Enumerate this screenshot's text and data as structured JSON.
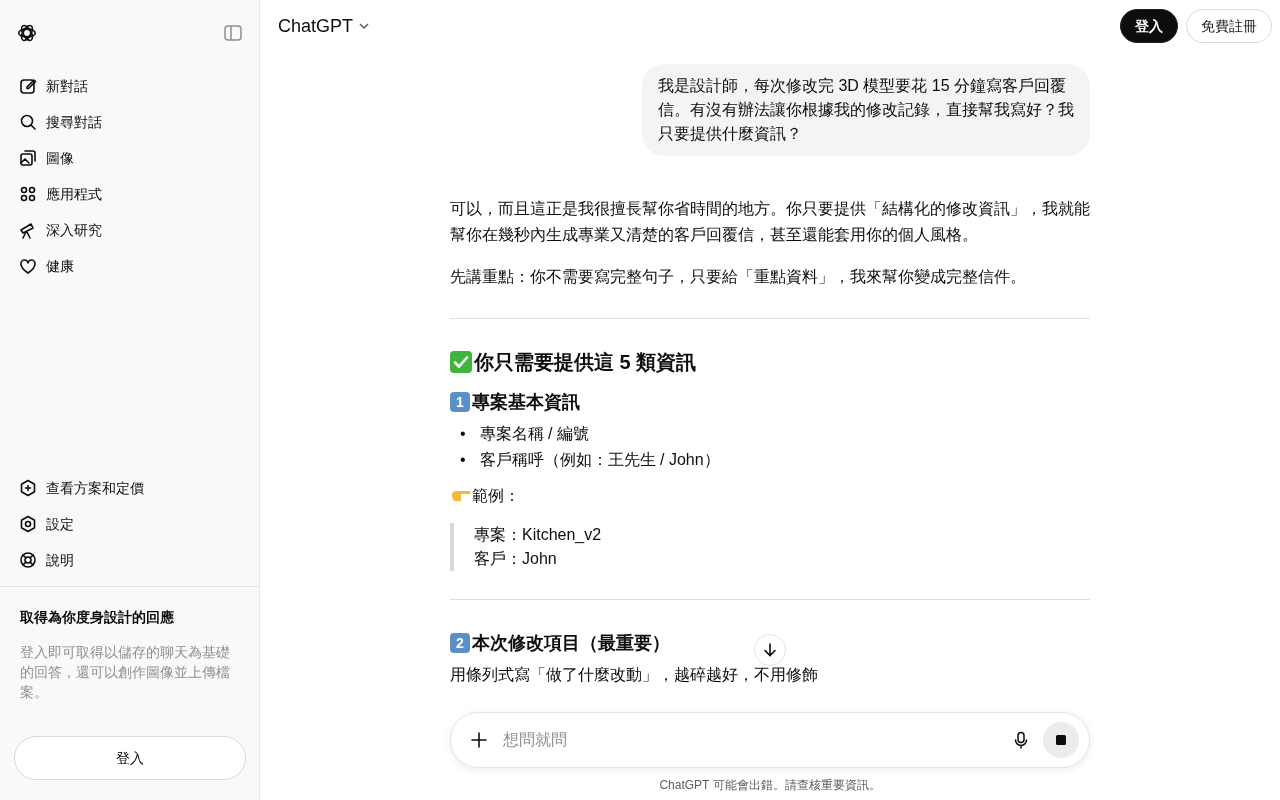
{
  "sidebar": {
    "nav": [
      {
        "kind": "edit",
        "label": "新對話"
      },
      {
        "kind": "search",
        "label": "搜尋對話"
      },
      {
        "kind": "images",
        "label": "圖像"
      },
      {
        "kind": "apps",
        "label": "應用程式"
      },
      {
        "kind": "telescope",
        "label": "深入研究"
      },
      {
        "kind": "heart",
        "label": "健康"
      }
    ],
    "footer_nav": [
      {
        "kind": "plan",
        "label": "查看方案和定價"
      },
      {
        "kind": "settings",
        "label": "設定"
      },
      {
        "kind": "help",
        "label": "說明"
      }
    ],
    "promo": {
      "title": "取得為你度身設計的回應",
      "text": "登入即可取得以儲存的聊天為基礎的回答，還可以創作圖像並上傳檔案。",
      "button": "登入"
    }
  },
  "header": {
    "title": "ChatGPT",
    "login": "登入",
    "signup": "免費註冊"
  },
  "conversation": {
    "user_message": "我是設計師，每次修改完 3D 模型要花 15 分鐘寫客戶回覆信。有沒有辦法讓你根據我的修改記錄，直接幫我寫好？我只要提供什麼資訊？",
    "answer": [
      {
        "kind": "paragraph",
        "text": "可以，而且這正是我很擅長幫你省時間的地方。你只要提供「結構化的修改資訊」，我就能幫你在幾秒內生成專業又清楚的客戶回覆信，甚至還能套用你的個人風格。"
      },
      {
        "kind": "paragraph",
        "text": "先講重點：你不需要寫完整句子，只要給「重點資料」，我來幫你變成完整信件。"
      },
      {
        "kind": "rule"
      },
      {
        "kind": "heading",
        "text": "你只需要提供這 5 類資訊"
      },
      {
        "kind": "subheading",
        "number": "1",
        "text": "專案基本資訊"
      },
      {
        "kind": "bullets",
        "marker": "•",
        "items": [
          "專案名稱 / 編號",
          "客戶稱呼（例如：王先生 / John）"
        ]
      },
      {
        "kind": "pointer",
        "text": "範例："
      },
      {
        "kind": "quote",
        "lines": [
          "專案：Kitchen_v2",
          "客戶：John"
        ]
      },
      {
        "kind": "rule"
      },
      {
        "kind": "subheading",
        "number": "2",
        "text": "本次修改項目（最重要）"
      },
      {
        "kind": "paragraph",
        "text": "用條列式寫「做了什麼改動」，越碎越好，不用修飾"
      }
    ]
  },
  "composer": {
    "placeholder": "想問就問",
    "disclaimer": "ChatGPT 可能會出錯。請查核重要資訊。"
  }
}
